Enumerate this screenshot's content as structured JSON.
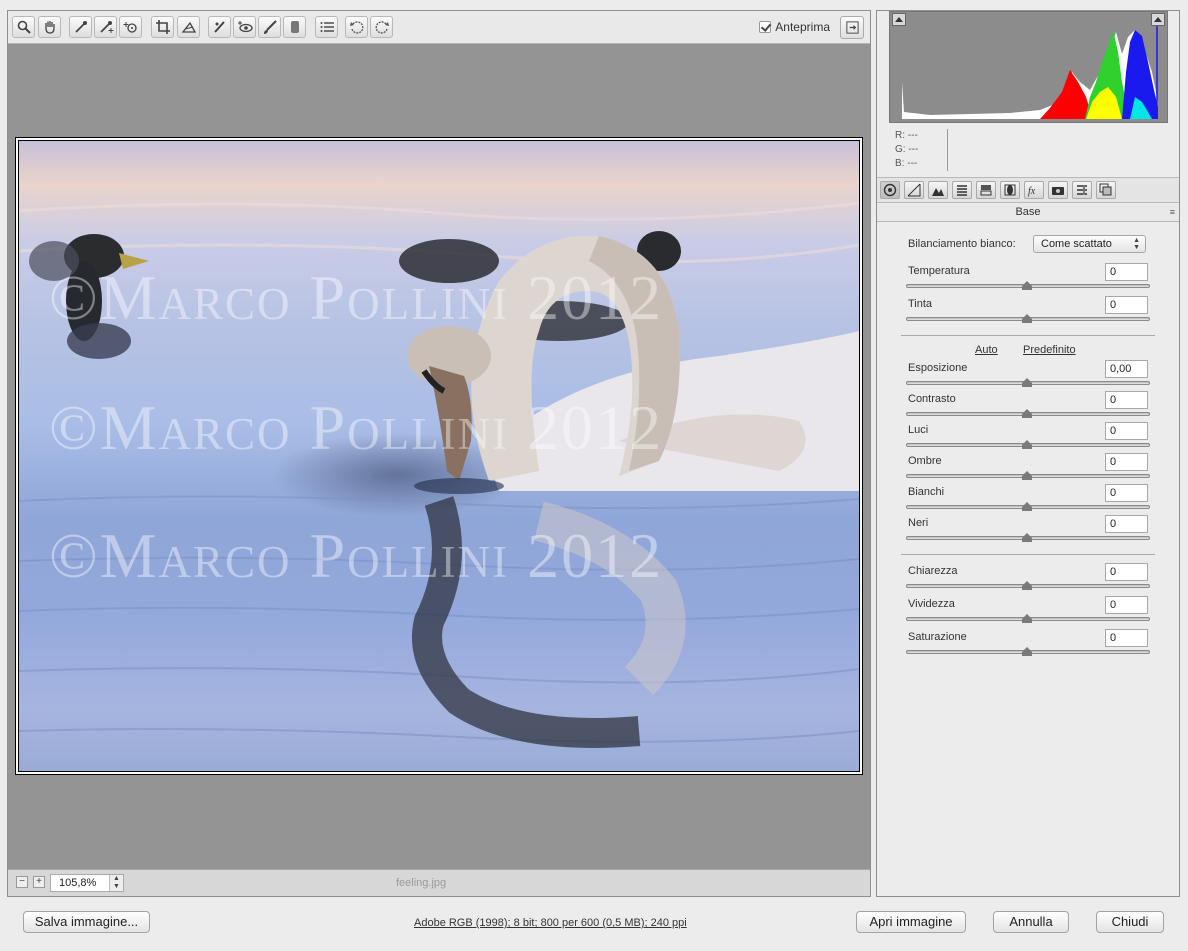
{
  "toolbar": {
    "tools": [
      "zoom-tool-icon",
      "hand-tool-icon",
      "white-balance-icon",
      "color-sampler-icon",
      "targeted-adjust-icon",
      "crop-icon",
      "straighten-icon",
      "spot-removal-icon",
      "red-eye-icon",
      "adjustment-brush-icon",
      "graduated-filter-icon",
      "preferences-icon",
      "rotate-left-icon",
      "rotate-right-icon"
    ],
    "preview_label": "Anteprima",
    "preview_checked": true
  },
  "photo": {
    "watermark": "©Marco Pollini 2012"
  },
  "statusbar": {
    "zoom_out": "−",
    "zoom_in": "+",
    "zoom_value": "105,8%",
    "filename": "feeling.jpg"
  },
  "histogram": {
    "r_label": "R:",
    "g_label": "G:",
    "b_label": "B:",
    "r_value": "---",
    "g_value": "---",
    "b_value": "---"
  },
  "panel": {
    "title": "Base",
    "menu_icon": "≡",
    "wb_label": "Bilanciamento bianco:",
    "wb_value": "Come scattato",
    "auto_link": "Auto",
    "default_link": "Predefinito",
    "sliders": [
      {
        "label": "Temperatura",
        "value": "0"
      },
      {
        "label": "Tinta",
        "value": "0"
      },
      {
        "label": "Esposizione",
        "value": "0,00"
      },
      {
        "label": "Contrasto",
        "value": "0"
      },
      {
        "label": "Luci",
        "value": "0"
      },
      {
        "label": "Ombre",
        "value": "0"
      },
      {
        "label": "Bianchi",
        "value": "0"
      },
      {
        "label": "Neri",
        "value": "0"
      },
      {
        "label": "Chiarezza",
        "value": "0"
      },
      {
        "label": "Vividezza",
        "value": "0"
      },
      {
        "label": "Saturazione",
        "value": "0"
      }
    ]
  },
  "footer": {
    "save_label": "Salva immagine...",
    "info_text": "Adobe RGB (1998); 8 bit; 800 per 600 (0,5 MB); 240 ppi",
    "open_label": "Apri immagine",
    "cancel_label": "Annulla",
    "close_label": "Chiudi"
  }
}
